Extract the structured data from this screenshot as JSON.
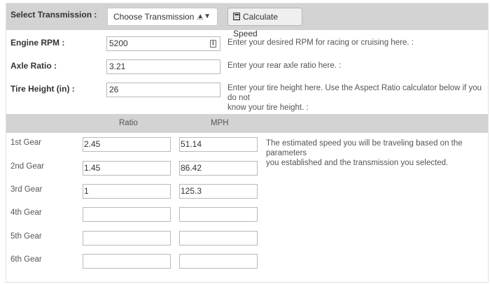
{
  "transmission": {
    "label": "Select Transmission :",
    "select_value": "Choose Transmission ...",
    "button_label": "Calculate Speed"
  },
  "params": [
    {
      "label": "Engine RPM :",
      "value": "5200",
      "help": "Enter your desired RPM for racing or cruising here. :"
    },
    {
      "label": "Axle Ratio :",
      "value": "3.21",
      "help": "Enter your rear axle ratio here. :"
    },
    {
      "label": "Tire Height (in) :",
      "value": "26",
      "help_line1": "Enter your tire height here. Use the Aspect Ratio calculator below if you do not",
      "help_line2": "know your tire height. :"
    }
  ],
  "gears": {
    "col_ratio": "Ratio",
    "col_mph": "MPH",
    "help_line1": "The estimated speed you will be traveling based on the parameters",
    "help_line2": "you established and the transmission you selected.",
    "rows": [
      {
        "label": "1st Gear",
        "ratio": "2.45",
        "mph": "51.14"
      },
      {
        "label": "2nd Gear",
        "ratio": "1.45",
        "mph": "86.42"
      },
      {
        "label": "3rd Gear",
        "ratio": "1",
        "mph": "125.3"
      },
      {
        "label": "4th Gear",
        "ratio": "",
        "mph": ""
      },
      {
        "label": "5th Gear",
        "ratio": "",
        "mph": ""
      },
      {
        "label": "6th Gear",
        "ratio": "",
        "mph": ""
      }
    ]
  }
}
